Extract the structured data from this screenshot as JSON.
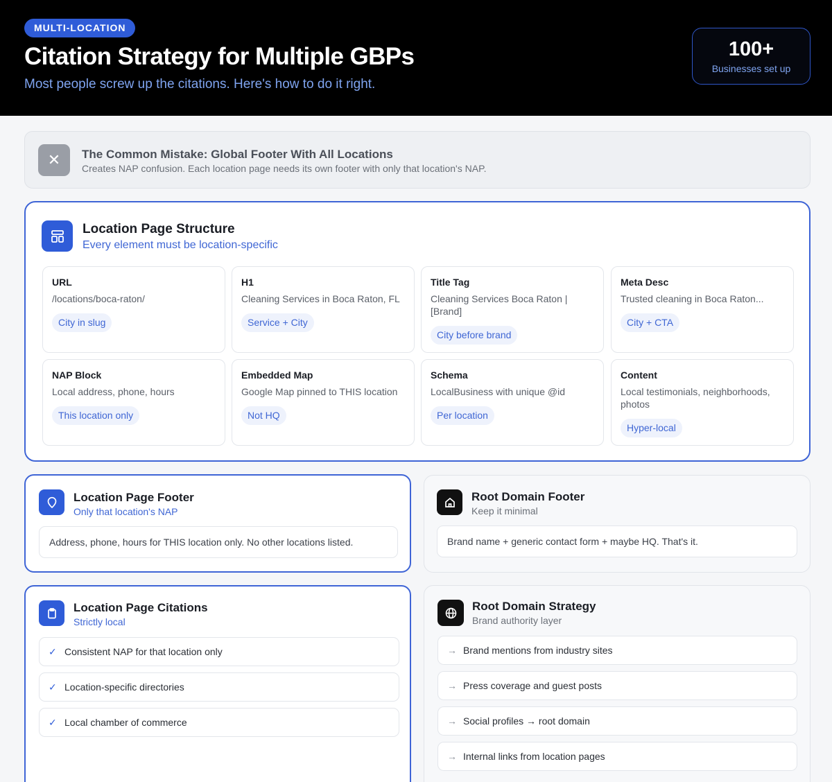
{
  "header": {
    "badge": "MULTI-LOCATION",
    "title": "Citation Strategy for Multiple GBPs",
    "subtitle": "Most people screw up the citations. Here's how to do it right.",
    "stat": {
      "value": "100+",
      "label": "Businesses set up"
    }
  },
  "mistake": {
    "icon": "close-icon",
    "title": "The Common Mistake: Global Footer With All Locations",
    "desc": "Creates NAP confusion. Each location page needs its own footer with only that location's NAP."
  },
  "structure": {
    "icon": "layout-icon",
    "title": "Location Page Structure",
    "subtitle": "Every element must be location-specific",
    "items": [
      {
        "label": "URL",
        "value": "/locations/boca-raton/",
        "tag": "City in slug"
      },
      {
        "label": "H1",
        "value": "Cleaning Services in Boca Raton, FL",
        "tag": "Service + City"
      },
      {
        "label": "Title Tag",
        "value": "Cleaning Services Boca Raton | [Brand]",
        "tag": "City before brand"
      },
      {
        "label": "Meta Desc",
        "value": "Trusted cleaning in Boca Raton...",
        "tag": "City + CTA"
      },
      {
        "label": "NAP Block",
        "value": "Local address, phone, hours",
        "tag": "This location only"
      },
      {
        "label": "Embedded Map",
        "value": "Google Map pinned to THIS location",
        "tag": "Not HQ"
      },
      {
        "label": "Schema",
        "value": "LocalBusiness with unique @id",
        "tag": "Per location"
      },
      {
        "label": "Content",
        "value": "Local testimonials, neighborhoods, photos",
        "tag": "Hyper-local"
      }
    ]
  },
  "location_footer": {
    "icon": "map-pin-icon",
    "title": "Location Page Footer",
    "subtitle": "Only that location's NAP",
    "text": "Address, phone, hours for THIS location only. No other locations listed."
  },
  "root_footer": {
    "icon": "home-icon",
    "title": "Root Domain Footer",
    "subtitle": "Keep it minimal",
    "text": "Brand name + generic contact form + maybe HQ. That's it."
  },
  "location_citations": {
    "icon": "clipboard-icon",
    "title": "Location Page Citations",
    "subtitle": "Strictly local",
    "items": [
      "Consistent NAP for that location only",
      "Location-specific directories",
      "Local chamber of commerce"
    ]
  },
  "root_strategy": {
    "icon": "globe-icon",
    "title": "Root Domain Strategy",
    "subtitle": "Brand authority layer",
    "items": [
      "Brand mentions from industry sites",
      "Press coverage and guest posts",
      "Social profiles → root domain",
      "Internal links from location pages"
    ]
  },
  "colors": {
    "accent": "#2f5cd8",
    "header_bg": "#000000",
    "accent_light": "#7fa4f0"
  }
}
